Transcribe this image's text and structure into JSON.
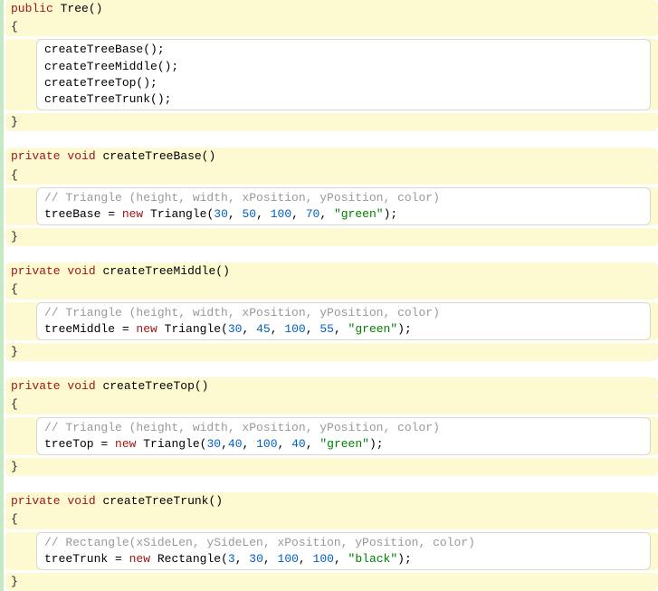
{
  "methods": [
    {
      "access": "public",
      "returnType": "",
      "name": "Tree",
      "params": "()",
      "body": {
        "comment": "",
        "lines": [
          "createTreeBase();",
          "createTreeMiddle();",
          "createTreeTop();",
          "createTreeTrunk();"
        ]
      }
    },
    {
      "access": "private",
      "returnType": "void",
      "name": "createTreeBase",
      "params": "()",
      "body": {
        "comment": "// Triangle (height, width, xPosition, yPosition, color)",
        "assign": {
          "var": "treeBase",
          "cls": "Triangle",
          "args_pre": "(",
          "n1": "30",
          "c1": ", ",
          "n2": "50",
          "c2": ", ",
          "n3": "100",
          "c3": ", ",
          "n4": "70",
          "c4": ", ",
          "str": "\"green\"",
          "args_post": ");"
        }
      }
    },
    {
      "access": "private",
      "returnType": "void",
      "name": "createTreeMiddle",
      "params": "()",
      "body": {
        "comment": "// Triangle (height, width, xPosition, yPosition, color)",
        "assign": {
          "var": "treeMiddle",
          "cls": "Triangle",
          "args_pre": "(",
          "n1": "30",
          "c1": ", ",
          "n2": "45",
          "c2": ", ",
          "n3": "100",
          "c3": ", ",
          "n4": "55",
          "c4": ", ",
          "str": "\"green\"",
          "args_post": ");"
        }
      }
    },
    {
      "access": "private",
      "returnType": "void",
      "name": "createTreeTop",
      "params": "()",
      "body": {
        "comment": "// Triangle (height, width, xPosition, yPosition, color)",
        "assign": {
          "var": "treeTop",
          "cls": "Triangle",
          "args_pre": "(",
          "n1": "30",
          "c1": ",",
          "n2": "40",
          "c2": ", ",
          "n3": "100",
          "c3": ", ",
          "n4": "40",
          "c4": ", ",
          "str": "\"green\"",
          "args_post": ");"
        }
      }
    },
    {
      "access": "private",
      "returnType": "void",
      "name": "createTreeTrunk",
      "params": "()",
      "body": {
        "comment": "// Rectangle(xSideLen, ySideLen, xPosition, yPosition, color)",
        "assign": {
          "var": "treeTrunk",
          "cls": "Rectangle",
          "args_pre": "(",
          "n1": "3",
          "c1": ", ",
          "n2": "30",
          "c2": ", ",
          "n3": "100",
          "c3": ", ",
          "n4": "100",
          "c4": ", ",
          "str": "\"black\"",
          "args_post": ");"
        }
      }
    }
  ],
  "tokens": {
    "openBrace": "{",
    "closeBrace": "}",
    "eqNew": " = ",
    "newKw": "new",
    "sp": " "
  }
}
